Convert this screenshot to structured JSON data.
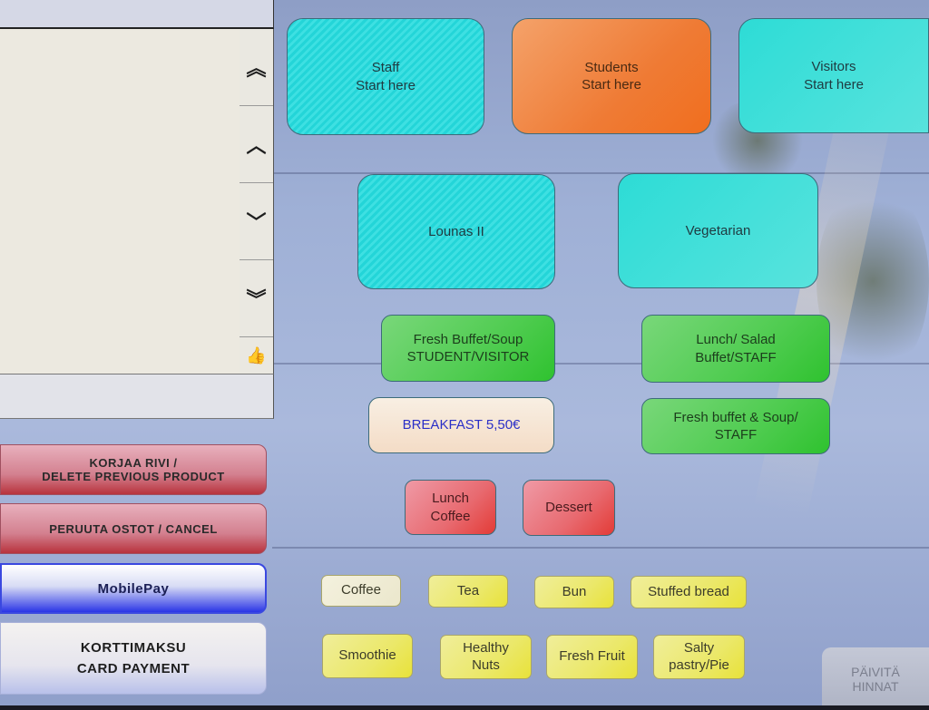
{
  "receipt_panel": {
    "scroll_buttons": [
      {
        "name": "scroll-top",
        "icon": "double-chevron-up-icon",
        "glyph": "︽"
      },
      {
        "name": "scroll-up",
        "icon": "chevron-up-icon",
        "glyph": "︿"
      },
      {
        "name": "scroll-down",
        "icon": "chevron-down-icon",
        "glyph": "﹀"
      },
      {
        "name": "scroll-bottom",
        "icon": "double-chevron-down-icon",
        "glyph": "︾"
      }
    ],
    "confirm_icon": {
      "icon": "thumbs-up-icon",
      "glyph": "👍"
    }
  },
  "actions": {
    "delete_line_1": "KORJAA RIVI /",
    "delete_line_2": "DELETE PREVIOUS PRODUCT",
    "cancel": "PERUUTA OSTOT / CANCEL",
    "mobilepay": "MobilePay",
    "card_line_1": "KORTTIMAKSU",
    "card_line_2": "CARD PAYMENT"
  },
  "categories": {
    "staff": [
      "Staff",
      "Start here"
    ],
    "students": [
      "Students",
      "Start here"
    ],
    "visitors": [
      "Visitors",
      "Start here"
    ],
    "lounas": "Lounas II",
    "vegetarian": "Vegetarian"
  },
  "products": {
    "fresh_buffet_student": [
      "Fresh Buffet/Soup",
      "STUDENT/VISITOR"
    ],
    "lunch_salad_staff": [
      "Lunch/ Salad",
      "Buffet/STAFF"
    ],
    "breakfast": "BREAKFAST 5,50€",
    "fresh_buffet_staff": [
      "Fresh buffet & Soup/",
      "STAFF"
    ],
    "lunch_coffee": [
      "Lunch",
      "Coffee"
    ],
    "dessert": "Dessert",
    "coffee": "Coffee",
    "tea": "Tea",
    "bun": "Bun",
    "stuffed_bread": "Stuffed bread",
    "smoothie": "Smoothie",
    "healthy_nuts": [
      "Healthy",
      "Nuts"
    ],
    "fresh_fruit": "Fresh Fruit",
    "salty_pastry": [
      "Salty",
      "pastry/Pie"
    ]
  },
  "update_prices": [
    "PÄIVITÄ",
    "HINNAT"
  ]
}
